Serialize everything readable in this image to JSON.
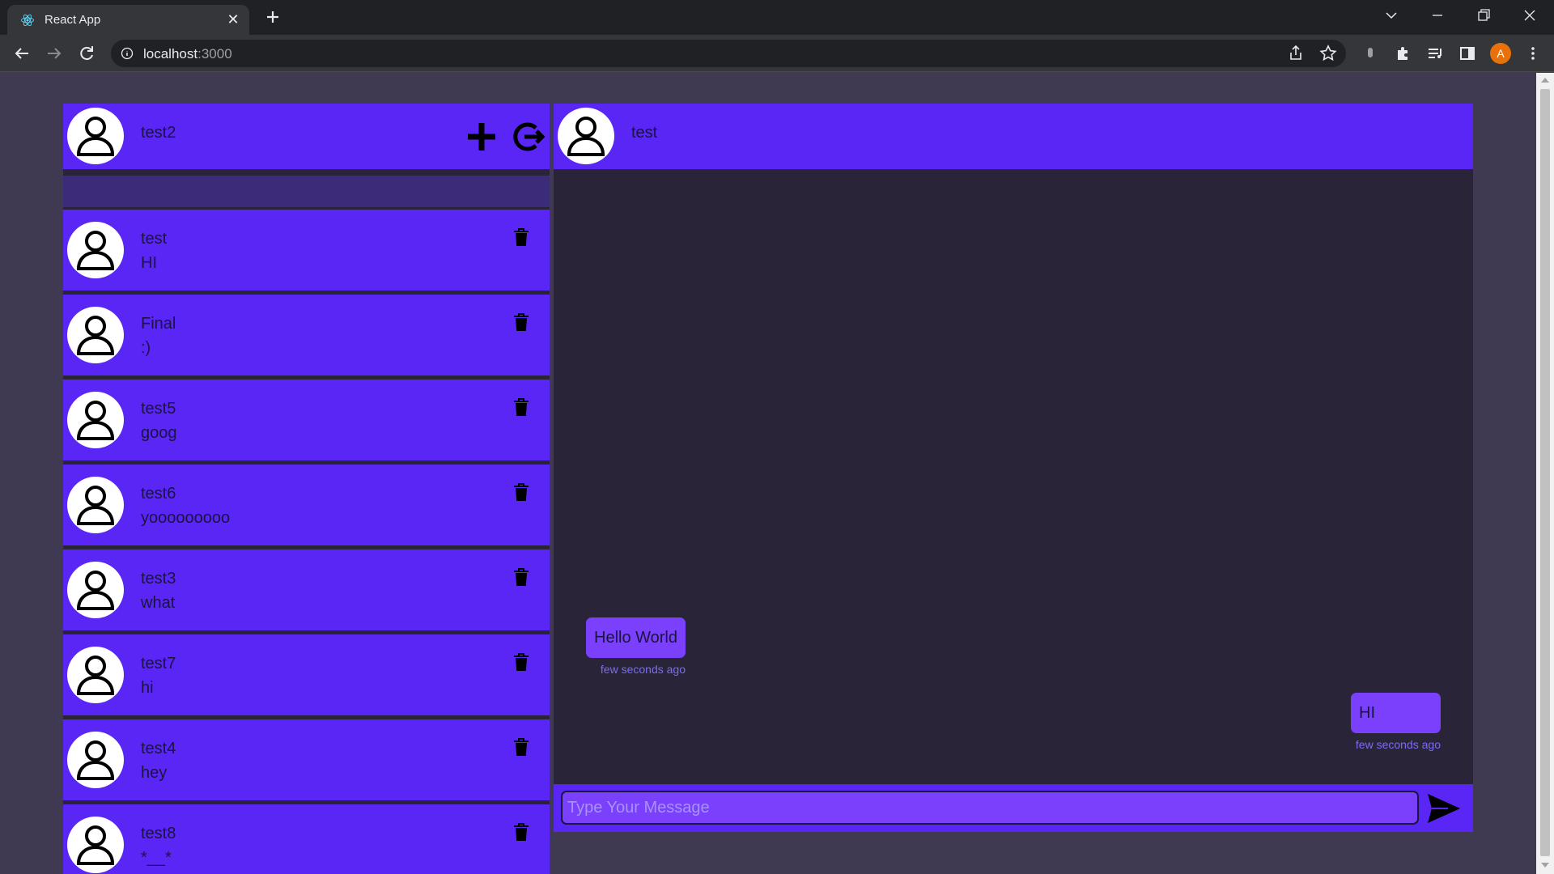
{
  "browser": {
    "tab_title": "React App",
    "tab_close": "✕",
    "url_host": "localhost",
    "url_port": ":3000",
    "profile_initial": "A"
  },
  "sidebar": {
    "current_user": "test2",
    "contacts": [
      {
        "name": "test",
        "last_message": "HI"
      },
      {
        "name": "Final",
        "last_message": ":)"
      },
      {
        "name": "test5",
        "last_message": "goog"
      },
      {
        "name": "test6",
        "last_message": "yooooooooo"
      },
      {
        "name": "test3",
        "last_message": "what"
      },
      {
        "name": "test7",
        "last_message": "hi"
      },
      {
        "name": "test4",
        "last_message": "hey"
      },
      {
        "name": "test8",
        "last_message": "*__*"
      }
    ]
  },
  "chat": {
    "partner_name": "test",
    "messages": [
      {
        "text": "Hello World",
        "time": "few seconds ago",
        "direction": "incoming"
      },
      {
        "text": "HI",
        "time": "few seconds ago",
        "direction": "outgoing"
      }
    ],
    "input_placeholder": "Type Your Message"
  },
  "colors": {
    "accent": "#5a26f6",
    "bubble": "#7b40fb",
    "background": "#2a2438",
    "page": "#3f3a51"
  },
  "icons": {
    "add": "plus-icon",
    "logout": "logout-icon",
    "delete": "trash-icon",
    "send": "send-icon",
    "avatar": "user-icon"
  }
}
